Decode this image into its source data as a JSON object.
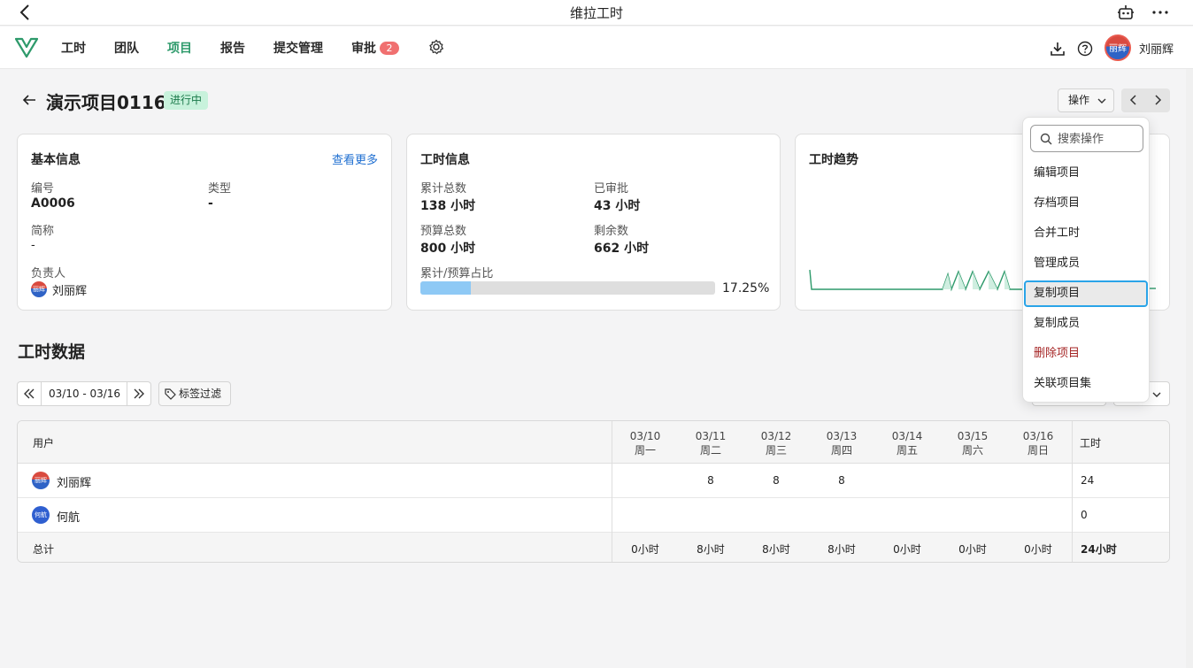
{
  "window": {
    "title": "维拉工时"
  },
  "nav": {
    "items": [
      {
        "label": "工时"
      },
      {
        "label": "团队"
      },
      {
        "label": "项目"
      },
      {
        "label": "报告"
      },
      {
        "label": "提交管理"
      },
      {
        "label": "审批"
      }
    ],
    "active": "项目",
    "approval_badge": "2",
    "user_name": "刘丽辉",
    "avatar_text": "丽辉"
  },
  "project": {
    "title": "演示项目0116",
    "status": "进行中",
    "ops_label": "操作"
  },
  "basic_info": {
    "title": "基本信息",
    "more_link": "查看更多",
    "code_label": "编号",
    "code_value": "A0006",
    "type_label": "类型",
    "type_value": "-",
    "short_label": "简称",
    "short_value": "-",
    "owner_label": "负责人",
    "owner_value": "刘丽辉"
  },
  "hours_info": {
    "title": "工时信息",
    "total_label": "累计总数",
    "total_value": "138 小时",
    "approved_label": "已审批",
    "approved_value": "43 小时",
    "budget_label": "预算总数",
    "budget_value": "800 小时",
    "remain_label": "剩余数",
    "remain_value": "662 小时",
    "ratio_label": "累计/预算占比",
    "ratio_text": "17.25%",
    "ratio_fraction": 0.1725
  },
  "trend": {
    "title": "工时趋势"
  },
  "timesheet": {
    "title": "工时数据",
    "range": "03/10 - 03/16",
    "tag_filter": "标签过滤",
    "user_header": "用户",
    "total_header": "工时",
    "days": [
      {
        "date": "03/10",
        "weekday": "周一"
      },
      {
        "date": "03/11",
        "weekday": "周二"
      },
      {
        "date": "03/12",
        "weekday": "周三"
      },
      {
        "date": "03/13",
        "weekday": "周四"
      },
      {
        "date": "03/14",
        "weekday": "周五"
      },
      {
        "date": "03/15",
        "weekday": "周六"
      },
      {
        "date": "03/16",
        "weekday": "周日"
      }
    ],
    "rows": [
      {
        "name": "刘丽辉",
        "avatar": "丽辉",
        "hours": [
          "",
          "8",
          "8",
          "8",
          "",
          "",
          ""
        ],
        "total": "24"
      },
      {
        "name": "何航",
        "avatar": "何航",
        "hours": [
          "",
          "",
          "",
          "",
          "",
          "",
          ""
        ],
        "total": "0"
      }
    ],
    "footer": {
      "label": "总计",
      "hours": [
        "0小时",
        "8小时",
        "8小时",
        "8小时",
        "0小时",
        "0小时",
        "0小时"
      ],
      "total": "24小时"
    }
  },
  "ops_menu": {
    "search_placeholder": "搜索操作",
    "items": [
      "编辑项目",
      "存档项目",
      "合并工时",
      "管理成员",
      "复制项目",
      "复制成员",
      "删除项目",
      "关联项目集"
    ],
    "focused": "复制项目",
    "danger": "删除项目"
  },
  "colors": {
    "accent": "#2e9a6b",
    "link": "#1f6fd1",
    "badge": "#f07070",
    "progress": "#8ec9f5",
    "danger": "#a52424",
    "focus": "#2aa4e8"
  }
}
